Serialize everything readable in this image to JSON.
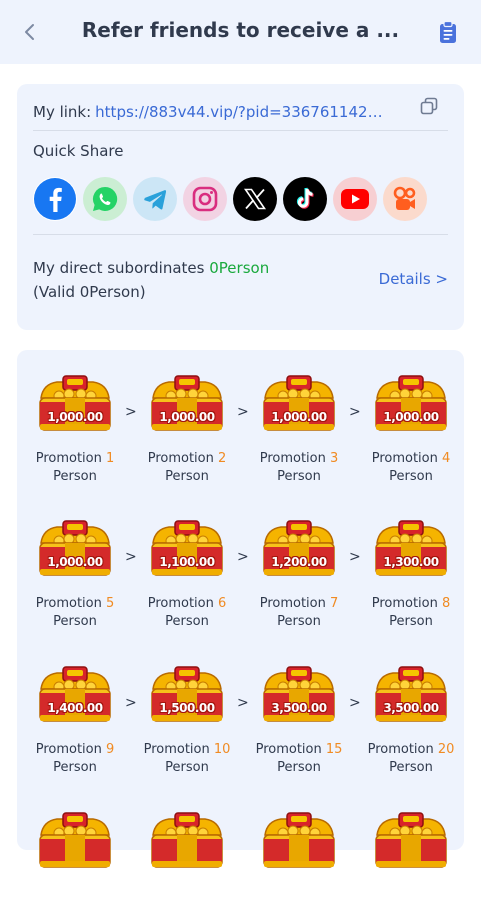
{
  "header": {
    "title": "Refer friends to receive a ..."
  },
  "link": {
    "label": "My link:",
    "url": "https://883v44.vip/?pid=3367611421&f..."
  },
  "quick_share": {
    "label": "Quick Share",
    "icons": [
      "facebook-icon",
      "whatsapp-icon",
      "telegram-icon",
      "instagram-icon",
      "x-icon",
      "tiktok-icon",
      "youtube-icon",
      "kwai-icon"
    ]
  },
  "subordinates": {
    "prefix": "My direct subordinates ",
    "count": "0Person",
    "valid": " (Valid 0Person)",
    "details": "Details >"
  },
  "rewards": [
    {
      "amount": "1,000.00",
      "label": "Promotion",
      "num": "1",
      "unit": "Person"
    },
    {
      "amount": "1,000.00",
      "label": "Promotion",
      "num": "2",
      "unit": "Person"
    },
    {
      "amount": "1,000.00",
      "label": "Promotion",
      "num": "3",
      "unit": "Person"
    },
    {
      "amount": "1,000.00",
      "label": "Promotion",
      "num": "4",
      "unit": "Person"
    },
    {
      "amount": "1,000.00",
      "label": "Promotion",
      "num": "5",
      "unit": "Person"
    },
    {
      "amount": "1,100.00",
      "label": "Promotion",
      "num": "6",
      "unit": "Person"
    },
    {
      "amount": "1,200.00",
      "label": "Promotion",
      "num": "7",
      "unit": "Person"
    },
    {
      "amount": "1,300.00",
      "label": "Promotion",
      "num": "8",
      "unit": "Person"
    },
    {
      "amount": "1,400.00",
      "label": "Promotion",
      "num": "9",
      "unit": "Person"
    },
    {
      "amount": "1,500.00",
      "label": "Promotion",
      "num": "10",
      "unit": "Person"
    },
    {
      "amount": "3,500.00",
      "label": "Promotion",
      "num": "15",
      "unit": "Person"
    },
    {
      "amount": "3,500.00",
      "label": "Promotion",
      "num": "20",
      "unit": "Person"
    },
    {
      "amount": "",
      "label": "",
      "num": "",
      "unit": ""
    },
    {
      "amount": "",
      "label": "",
      "num": "",
      "unit": ""
    },
    {
      "amount": "",
      "label": "",
      "num": "",
      "unit": ""
    },
    {
      "amount": "",
      "label": "",
      "num": "",
      "unit": ""
    }
  ],
  "arrow": ">",
  "colors": {
    "accent_blue": "#3a6ad5",
    "green": "#1aa93d",
    "orange": "#f08b23",
    "card_bg": "#eef3fd"
  }
}
